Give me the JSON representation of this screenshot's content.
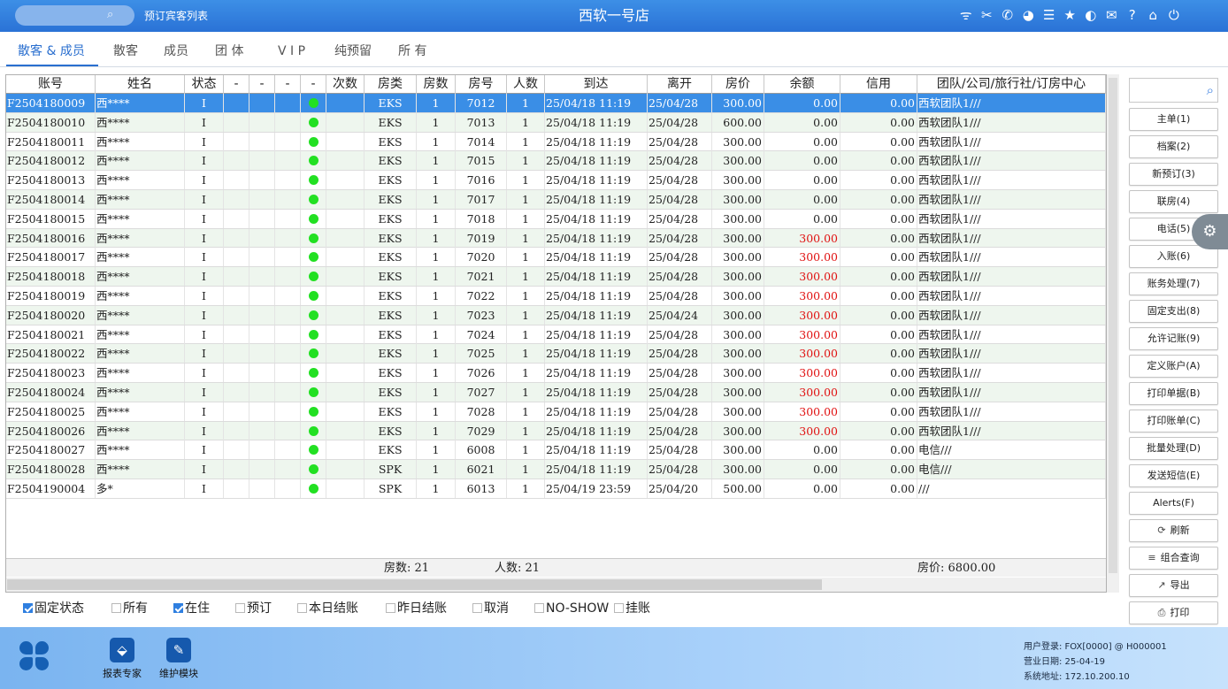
{
  "topbar": {
    "search_icon": "search-icon",
    "breadcrumb": "预订宾客列表",
    "title": "西软一号店",
    "icons": [
      "wifi-icon",
      "tools-icon",
      "phone-icon",
      "palette-icon",
      "menu-icon",
      "star-icon",
      "contrast-icon",
      "mail-icon",
      "help-icon",
      "home-icon",
      "power-icon"
    ],
    "icon_glyphs": [
      "ᯤ",
      "✂",
      "✆",
      "◕",
      "☰",
      "★",
      "◐",
      "✉",
      "?",
      "⌂",
      "⏻"
    ]
  },
  "tabs": [
    "散客 & 成员",
    "散客",
    "成员",
    "团 体",
    "V I P",
    "纯预留",
    "所 有"
  ],
  "active_tab": 0,
  "columns": [
    "账号",
    "姓名",
    "状态",
    "-",
    "-",
    "-",
    "-",
    "次数",
    "房类",
    "房数",
    "房号",
    "人数",
    "到达",
    "离开",
    "房价",
    "余额",
    "信用",
    "团队/公司/旅行社/订房中心"
  ],
  "rows": [
    {
      "acct": "F2504180009",
      "name": "西****",
      "status": "I",
      "count": "",
      "rtype": "EKS",
      "rooms": "1",
      "room": "7012",
      "persons": "1",
      "arr": "25/04/18 11:19",
      "dep": "25/04/28",
      "rate": "300.00",
      "bal": "0.00",
      "credit": "0.00",
      "group": "西软团队1///",
      "selected": true,
      "neg": false
    },
    {
      "acct": "F2504180010",
      "name": "西****",
      "status": "I",
      "count": "",
      "rtype": "EKS",
      "rooms": "1",
      "room": "7013",
      "persons": "1",
      "arr": "25/04/18 11:19",
      "dep": "25/04/28",
      "rate": "600.00",
      "bal": "0.00",
      "credit": "0.00",
      "group": "西软团队1///",
      "selected": false,
      "neg": false
    },
    {
      "acct": "F2504180011",
      "name": "西****",
      "status": "I",
      "count": "",
      "rtype": "EKS",
      "rooms": "1",
      "room": "7014",
      "persons": "1",
      "arr": "25/04/18 11:19",
      "dep": "25/04/28",
      "rate": "300.00",
      "bal": "0.00",
      "credit": "0.00",
      "group": "西软团队1///",
      "selected": false,
      "neg": false
    },
    {
      "acct": "F2504180012",
      "name": "西****",
      "status": "I",
      "count": "",
      "rtype": "EKS",
      "rooms": "1",
      "room": "7015",
      "persons": "1",
      "arr": "25/04/18 11:19",
      "dep": "25/04/28",
      "rate": "300.00",
      "bal": "0.00",
      "credit": "0.00",
      "group": "西软团队1///",
      "selected": false,
      "neg": false
    },
    {
      "acct": "F2504180013",
      "name": "西****",
      "status": "I",
      "count": "",
      "rtype": "EKS",
      "rooms": "1",
      "room": "7016",
      "persons": "1",
      "arr": "25/04/18 11:19",
      "dep": "25/04/28",
      "rate": "300.00",
      "bal": "0.00",
      "credit": "0.00",
      "group": "西软团队1///",
      "selected": false,
      "neg": false
    },
    {
      "acct": "F2504180014",
      "name": "西****",
      "status": "I",
      "count": "",
      "rtype": "EKS",
      "rooms": "1",
      "room": "7017",
      "persons": "1",
      "arr": "25/04/18 11:19",
      "dep": "25/04/28",
      "rate": "300.00",
      "bal": "0.00",
      "credit": "0.00",
      "group": "西软团队1///",
      "selected": false,
      "neg": false
    },
    {
      "acct": "F2504180015",
      "name": "西****",
      "status": "I",
      "count": "",
      "rtype": "EKS",
      "rooms": "1",
      "room": "7018",
      "persons": "1",
      "arr": "25/04/18 11:19",
      "dep": "25/04/28",
      "rate": "300.00",
      "bal": "0.00",
      "credit": "0.00",
      "group": "西软团队1///",
      "selected": false,
      "neg": false
    },
    {
      "acct": "F2504180016",
      "name": "西****",
      "status": "I",
      "count": "",
      "rtype": "EKS",
      "rooms": "1",
      "room": "7019",
      "persons": "1",
      "arr": "25/04/18 11:19",
      "dep": "25/04/28",
      "rate": "300.00",
      "bal": "300.00",
      "credit": "0.00",
      "group": "西软团队1///",
      "selected": false,
      "neg": true
    },
    {
      "acct": "F2504180017",
      "name": "西****",
      "status": "I",
      "count": "",
      "rtype": "EKS",
      "rooms": "1",
      "room": "7020",
      "persons": "1",
      "arr": "25/04/18 11:19",
      "dep": "25/04/28",
      "rate": "300.00",
      "bal": "300.00",
      "credit": "0.00",
      "group": "西软团队1///",
      "selected": false,
      "neg": true
    },
    {
      "acct": "F2504180018",
      "name": "西****",
      "status": "I",
      "count": "",
      "rtype": "EKS",
      "rooms": "1",
      "room": "7021",
      "persons": "1",
      "arr": "25/04/18 11:19",
      "dep": "25/04/28",
      "rate": "300.00",
      "bal": "300.00",
      "credit": "0.00",
      "group": "西软团队1///",
      "selected": false,
      "neg": true
    },
    {
      "acct": "F2504180019",
      "name": "西****",
      "status": "I",
      "count": "",
      "rtype": "EKS",
      "rooms": "1",
      "room": "7022",
      "persons": "1",
      "arr": "25/04/18 11:19",
      "dep": "25/04/28",
      "rate": "300.00",
      "bal": "300.00",
      "credit": "0.00",
      "group": "西软团队1///",
      "selected": false,
      "neg": true
    },
    {
      "acct": "F2504180020",
      "name": "西****",
      "status": "I",
      "count": "",
      "rtype": "EKS",
      "rooms": "1",
      "room": "7023",
      "persons": "1",
      "arr": "25/04/18 11:19",
      "dep": "25/04/24",
      "rate": "300.00",
      "bal": "300.00",
      "credit": "0.00",
      "group": "西软团队1///",
      "selected": false,
      "neg": true
    },
    {
      "acct": "F2504180021",
      "name": "西****",
      "status": "I",
      "count": "",
      "rtype": "EKS",
      "rooms": "1",
      "room": "7024",
      "persons": "1",
      "arr": "25/04/18 11:19",
      "dep": "25/04/28",
      "rate": "300.00",
      "bal": "300.00",
      "credit": "0.00",
      "group": "西软团队1///",
      "selected": false,
      "neg": true
    },
    {
      "acct": "F2504180022",
      "name": "西****",
      "status": "I",
      "count": "",
      "rtype": "EKS",
      "rooms": "1",
      "room": "7025",
      "persons": "1",
      "arr": "25/04/18 11:19",
      "dep": "25/04/28",
      "rate": "300.00",
      "bal": "300.00",
      "credit": "0.00",
      "group": "西软团队1///",
      "selected": false,
      "neg": true
    },
    {
      "acct": "F2504180023",
      "name": "西****",
      "status": "I",
      "count": "",
      "rtype": "EKS",
      "rooms": "1",
      "room": "7026",
      "persons": "1",
      "arr": "25/04/18 11:19",
      "dep": "25/04/28",
      "rate": "300.00",
      "bal": "300.00",
      "credit": "0.00",
      "group": "西软团队1///",
      "selected": false,
      "neg": true
    },
    {
      "acct": "F2504180024",
      "name": "西****",
      "status": "I",
      "count": "",
      "rtype": "EKS",
      "rooms": "1",
      "room": "7027",
      "persons": "1",
      "arr": "25/04/18 11:19",
      "dep": "25/04/28",
      "rate": "300.00",
      "bal": "300.00",
      "credit": "0.00",
      "group": "西软团队1///",
      "selected": false,
      "neg": true
    },
    {
      "acct": "F2504180025",
      "name": "西****",
      "status": "I",
      "count": "",
      "rtype": "EKS",
      "rooms": "1",
      "room": "7028",
      "persons": "1",
      "arr": "25/04/18 11:19",
      "dep": "25/04/28",
      "rate": "300.00",
      "bal": "300.00",
      "credit": "0.00",
      "group": "西软团队1///",
      "selected": false,
      "neg": true
    },
    {
      "acct": "F2504180026",
      "name": "西****",
      "status": "I",
      "count": "",
      "rtype": "EKS",
      "rooms": "1",
      "room": "7029",
      "persons": "1",
      "arr": "25/04/18 11:19",
      "dep": "25/04/28",
      "rate": "300.00",
      "bal": "300.00",
      "credit": "0.00",
      "group": "西软团队1///",
      "selected": false,
      "neg": true
    },
    {
      "acct": "F2504180027",
      "name": "西****",
      "status": "I",
      "count": "",
      "rtype": "EKS",
      "rooms": "1",
      "room": "6008",
      "persons": "1",
      "arr": "25/04/18 11:19",
      "dep": "25/04/28",
      "rate": "300.00",
      "bal": "0.00",
      "credit": "0.00",
      "group": "电信///",
      "selected": false,
      "neg": false
    },
    {
      "acct": "F2504180028",
      "name": "西****",
      "status": "I",
      "count": "",
      "rtype": "SPK",
      "rooms": "1",
      "room": "6021",
      "persons": "1",
      "arr": "25/04/18 11:19",
      "dep": "25/04/28",
      "rate": "300.00",
      "bal": "0.00",
      "credit": "0.00",
      "group": "电信///",
      "selected": false,
      "neg": false
    },
    {
      "acct": "F2504190004",
      "name": "多*",
      "status": "I",
      "count": "",
      "rtype": "SPK",
      "rooms": "1",
      "room": "6013",
      "persons": "1",
      "arr": "25/04/19 23:59",
      "dep": "25/04/20",
      "rate": "500.00",
      "bal": "0.00",
      "credit": "0.00",
      "group": "///",
      "selected": false,
      "neg": false
    }
  ],
  "summary": {
    "rooms": "房数: 21",
    "persons": "人数: 21",
    "rate": "房价: 6800.00"
  },
  "filters": [
    {
      "label": "固定状态",
      "checked": true
    },
    {
      "label": "所有",
      "checked": false
    },
    {
      "label": "在住",
      "checked": true
    },
    {
      "label": "预订",
      "checked": false
    },
    {
      "label": "本日结账",
      "checked": false
    },
    {
      "label": "昨日结账",
      "checked": false
    },
    {
      "label": "取消",
      "checked": false
    },
    {
      "label": "NO-SHOW",
      "checked": false
    },
    {
      "label": "挂账",
      "checked": false
    }
  ],
  "sidebar": {
    "search_placeholder": "",
    "buttons": [
      {
        "label": "主单(1)",
        "icon": ""
      },
      {
        "label": "档案(2)",
        "icon": ""
      },
      {
        "label": "新预订(3)",
        "icon": ""
      },
      {
        "label": "联房(4)",
        "icon": ""
      },
      {
        "label": "电话(5)",
        "icon": ""
      },
      {
        "label": "入账(6)",
        "icon": ""
      },
      {
        "label": "账务处理(7)",
        "icon": ""
      },
      {
        "label": "固定支出(8)",
        "icon": ""
      },
      {
        "label": "允许记账(9)",
        "icon": ""
      },
      {
        "label": "定义账户(A)",
        "icon": ""
      },
      {
        "label": "打印单据(B)",
        "icon": ""
      },
      {
        "label": "打印账单(C)",
        "icon": ""
      },
      {
        "label": "批量处理(D)",
        "icon": ""
      },
      {
        "label": "发送短信(E)",
        "icon": ""
      },
      {
        "label": "Alerts(F)",
        "icon": ""
      },
      {
        "label": "刷新",
        "icon": "⟳"
      },
      {
        "label": "组合查询",
        "icon": "≡"
      },
      {
        "label": "导出",
        "icon": "↗"
      },
      {
        "label": "打印",
        "icon": "⎙"
      }
    ]
  },
  "bottom": {
    "modules": [
      {
        "label": "报表专家",
        "icon": "graduation-cap-icon",
        "glyph": "⬙"
      },
      {
        "label": "维护模块",
        "icon": "wrench-icon",
        "glyph": "✎"
      }
    ],
    "sysinfo": [
      "用户登录: FOX[0000] @ H000001",
      "营业日期: 25-04-19",
      "系统地址: 172.10.200.10"
    ]
  }
}
